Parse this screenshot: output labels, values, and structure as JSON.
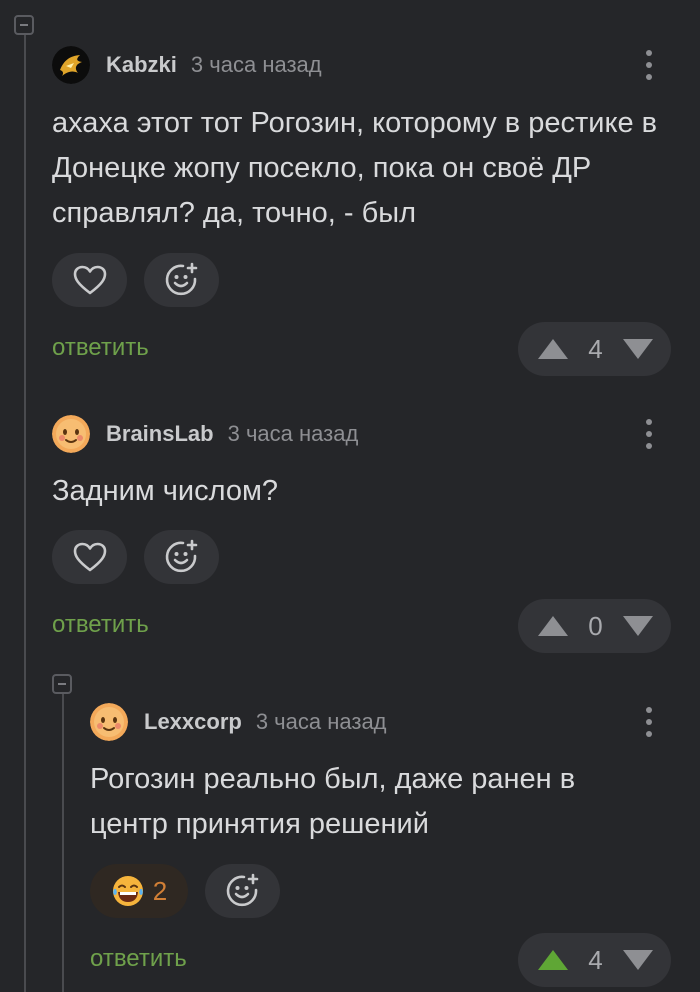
{
  "comments": [
    {
      "author": "Kabzki",
      "time": "3 часа назад",
      "text": "ахаха этот тот Рогозин, которому в рестике в Донецке жопу посекло, пока он своё ДР справлял? да, точно, - был",
      "reply_label": "ответить",
      "rating": "4",
      "upvoted": false,
      "avatar_icon": "dragon-avatar-icon"
    },
    {
      "author": "BrainsLab",
      "time": "3 часа назад",
      "text": "Задним числом?",
      "reply_label": "ответить",
      "rating": "0",
      "upvoted": false,
      "avatar_icon": "smiley-avatar-icon"
    },
    {
      "author": "Lexxcorp",
      "time": "3 часа назад",
      "text": "Рогозин реально был, даже ранен в центр принятия решений",
      "reply_label": "ответить",
      "rating": "4",
      "upvoted": true,
      "reaction_count": "2",
      "reaction_icon": "laughing-emoji-icon",
      "avatar_icon": "smiley-avatar-icon"
    }
  ],
  "colors": {
    "background": "#252629",
    "pill": "#333438",
    "reply_green": "#6fa14b",
    "upvote_active": "#5fa635",
    "reaction_count": "#d17f36"
  }
}
